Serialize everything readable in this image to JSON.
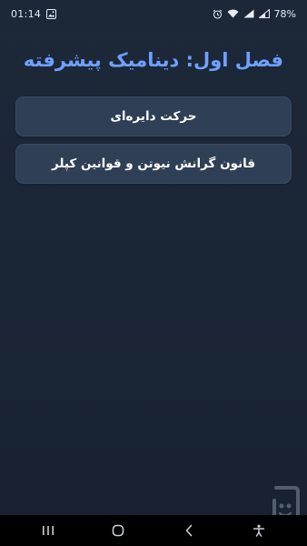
{
  "status_bar": {
    "time": "01:14",
    "battery": "78%",
    "icons": [
      "image-icon",
      "alarm-icon",
      "wifi-icon",
      "signal-icon",
      "signal-icon",
      "battery-icon"
    ]
  },
  "page": {
    "title": "فصل اول: دینامیک پیشرفته"
  },
  "menu": {
    "items": [
      {
        "label": "حرکت دایره‌ای"
      },
      {
        "label": "قانون گرانش نیوتن و قوانین کپلر"
      }
    ]
  },
  "nav_bar": {
    "buttons": [
      "recent-apps",
      "home",
      "back",
      "accessibility"
    ]
  },
  "colors": {
    "background": "#1b2637",
    "title": "#6fa0ff",
    "card": "#2f3f56",
    "card_text": "#ffffff"
  }
}
